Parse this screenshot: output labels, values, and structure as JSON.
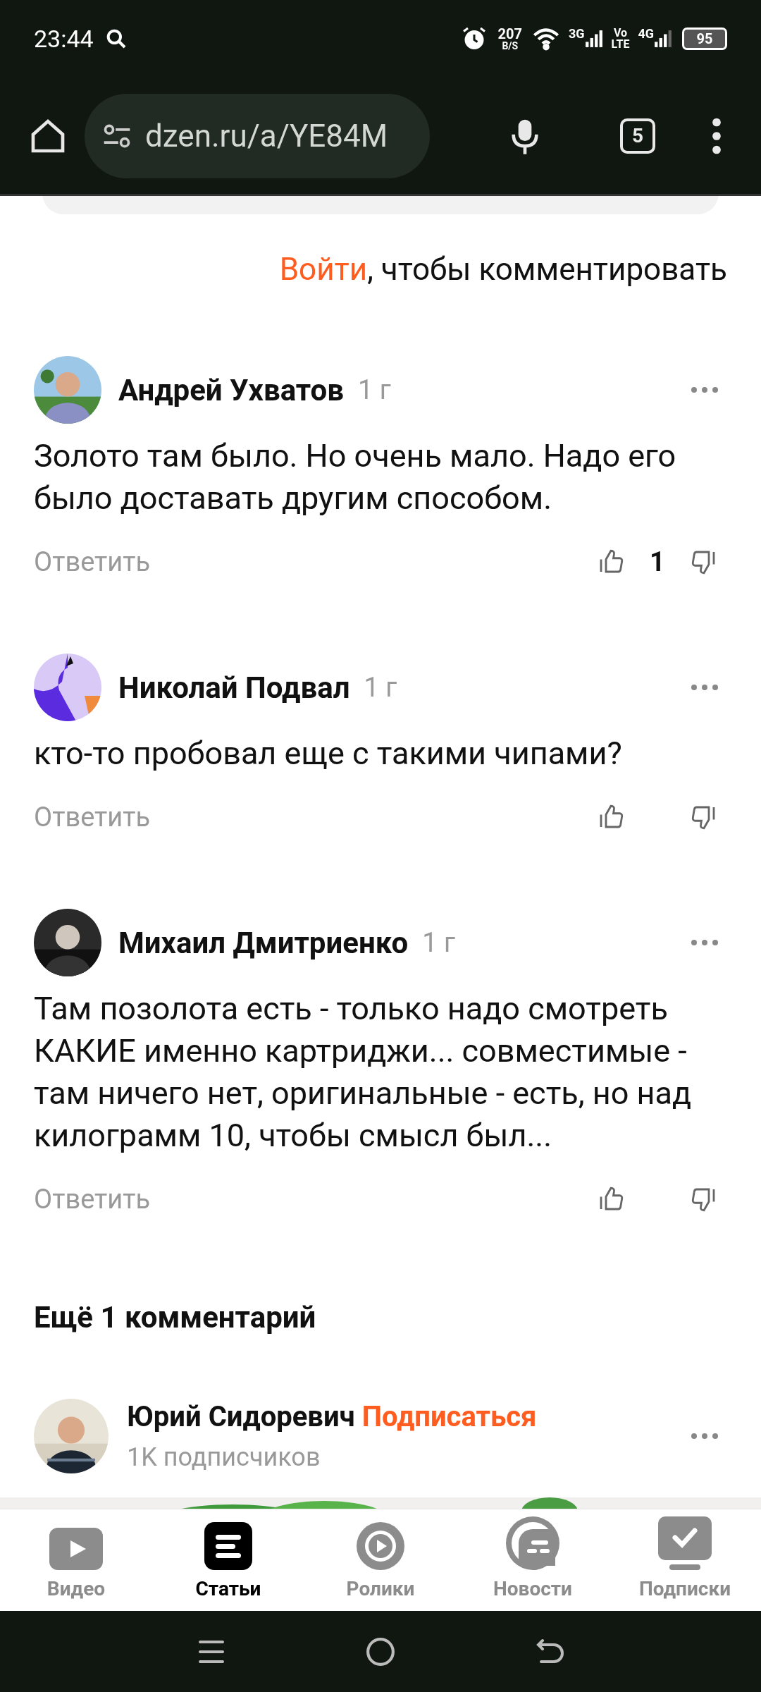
{
  "status_bar": {
    "time": "23:44",
    "speed": "207",
    "speed_unit": "B/S",
    "net1": "3G",
    "volte_top": "Vo",
    "volte_bottom": "LTE",
    "net2": "4G",
    "battery": "95"
  },
  "browser": {
    "url": "dzen.ru/a/YE84M",
    "tab_count": "5"
  },
  "login_prompt": {
    "link": "Войти",
    "text": ", чтобы комментировать"
  },
  "comments": [
    {
      "author": "Андрей Ухватов",
      "time": "1 г",
      "text": "Золото там было. Но очень мало. Надо его было доставать другим способом.",
      "reply": "Ответить",
      "likes": "1"
    },
    {
      "author": "Николай Подвал",
      "kind": "graphic",
      "time": "1 г",
      "text": "кто-то пробовал еще с такими чипами?",
      "reply": "Ответить"
    },
    {
      "author": "Михаил Дмитриенко",
      "time": "1 г",
      "text": "Там позолота есть - только надо смотреть КАКИЕ именно картриджи... совместимые - там ничего нет, оригинальные - есть, но над килограмм 10, чтобы смысл был...",
      "reply": "Ответить"
    }
  ],
  "more_comments": "Ещё 1 комментарий",
  "channel": {
    "name": "Юрий Сидоревич",
    "subscribe": "Подписаться",
    "subscribers": "1K подписчиков"
  },
  "bottom_nav": [
    {
      "label": "Видео",
      "kind": "video",
      "selected": false
    },
    {
      "label": "Статьи",
      "kind": "articles",
      "selected": true
    },
    {
      "label": "Ролики",
      "kind": "clips",
      "selected": false
    },
    {
      "label": "Новости",
      "kind": "news",
      "selected": false
    },
    {
      "label": "Подписки",
      "kind": "subs",
      "selected": false
    }
  ]
}
